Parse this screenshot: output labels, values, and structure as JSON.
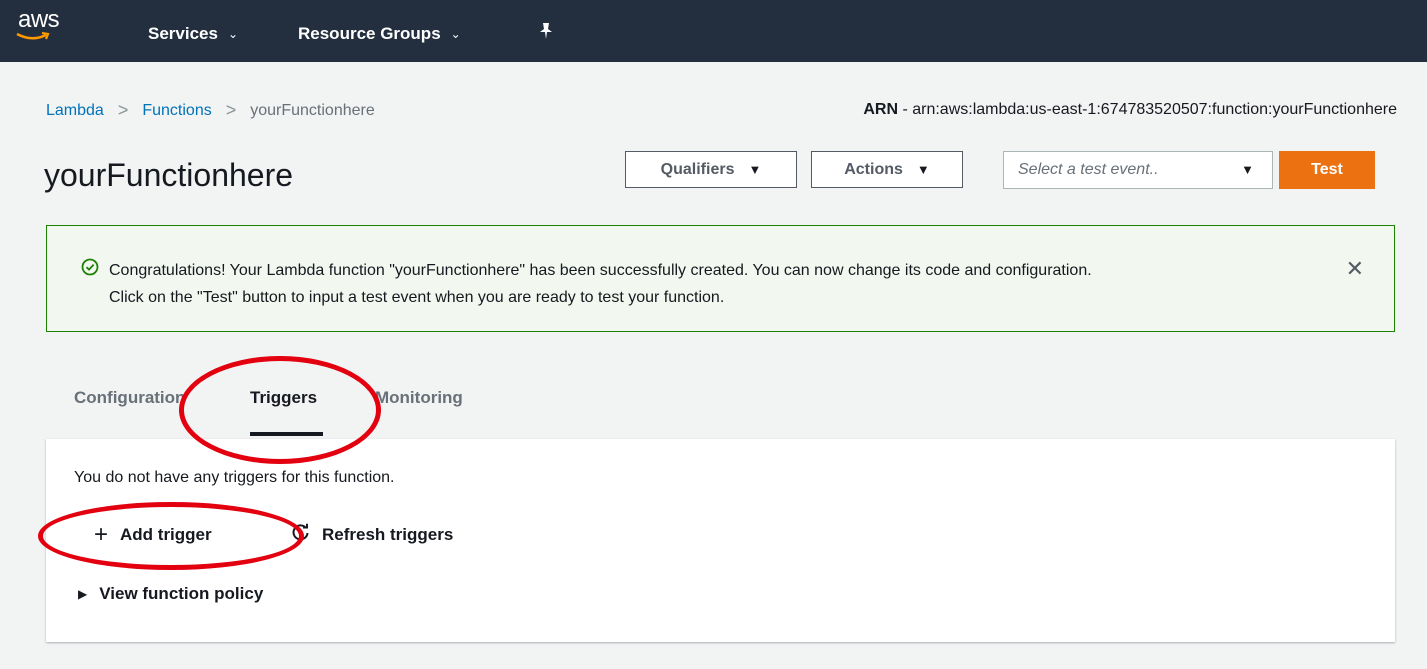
{
  "topbar": {
    "logo_text": "aws",
    "services_label": "Services",
    "resource_groups_label": "Resource Groups",
    "pin_icon": "pin-icon"
  },
  "breadcrumb": {
    "items": [
      "Lambda",
      "Functions",
      "yourFunctionhere"
    ],
    "separator": ">"
  },
  "arn": {
    "label": "ARN",
    "dash": " - ",
    "value": "arn:aws:lambda:us-east-1:674783520507:function:yourFunctionhere"
  },
  "page_title": "yourFunctionhere",
  "toolbar": {
    "qualifiers_label": "Qualifiers",
    "actions_label": "Actions",
    "test_event_placeholder": "Select a test event..",
    "test_label": "Test"
  },
  "flash": {
    "line1": "Congratulations! Your Lambda function \"yourFunctionhere\" has been successfully created. You can now change its code and configuration.",
    "line2": "Click on the \"Test\" button to input a test event when you are ready to test your function.",
    "icon": "check-circle-icon",
    "close_glyph": "✕"
  },
  "tabs": [
    "Configuration",
    "Triggers",
    "Monitoring"
  ],
  "active_tab": "Triggers",
  "triggers_panel": {
    "empty_message": "You do not have any triggers for this function.",
    "add_trigger_label": "Add trigger",
    "refresh_triggers_label": "Refresh triggers",
    "view_policy_label": "View function policy"
  },
  "colors": {
    "nav_bg": "#232f3e",
    "link": "#0073bb",
    "primary_button": "#ec7211",
    "success_border": "#1d8102",
    "annotation": "#e3000f"
  }
}
